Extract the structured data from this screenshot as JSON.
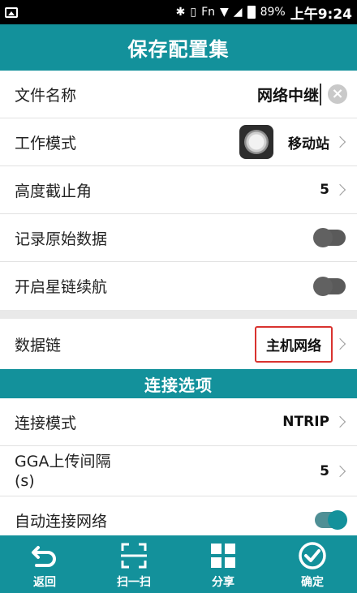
{
  "status_bar": {
    "icons": [
      "image-icon",
      "bluetooth-icon",
      "vibrate-icon",
      "fn-icon",
      "wifi-icon",
      "no-signal-icon",
      "battery-icon"
    ],
    "fn_label": "Fn",
    "battery": "89%",
    "time": "上午9:24"
  },
  "header": {
    "title": "保存配置集"
  },
  "settings": {
    "file_name": {
      "label": "文件名称",
      "value": "网络中继"
    },
    "work_mode": {
      "label": "工作模式",
      "value": "移动站"
    },
    "cutoff_angle": {
      "label": "高度截止角",
      "value": "5"
    },
    "record_raw": {
      "label": "记录原始数据",
      "enabled": false
    },
    "starlink": {
      "label": "开启星链续航",
      "enabled": false
    },
    "datalink": {
      "label": "数据链",
      "value": "主机网络"
    }
  },
  "connection": {
    "section_title": "连接选项",
    "mode": {
      "label": "连接模式",
      "value": "NTRIP"
    },
    "gga": {
      "label_line1": "GGA上传间隔",
      "label_line2": "(s)",
      "value": "5"
    },
    "auto_connect": {
      "label": "自动连接网络",
      "enabled": true
    }
  },
  "bottom_nav": [
    {
      "label": "返回",
      "icon": "back-arrow-icon"
    },
    {
      "label": "扫一扫",
      "icon": "scan-icon"
    },
    {
      "label": "分享",
      "icon": "grid-icon"
    },
    {
      "label": "确定",
      "icon": "check-circle-icon"
    }
  ],
  "colors": {
    "accent": "#13919b",
    "highlight_border": "#d9332f"
  }
}
